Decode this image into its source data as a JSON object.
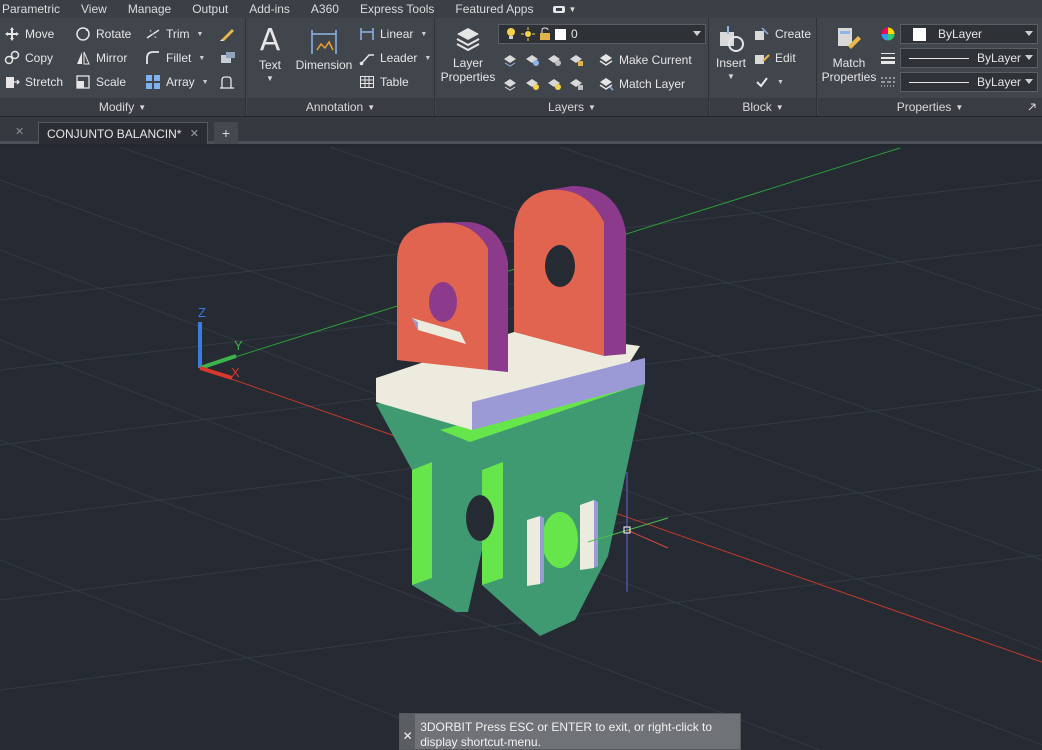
{
  "menubar": {
    "items": [
      "Parametric",
      "View",
      "Manage",
      "Output",
      "Add-ins",
      "A360",
      "Express Tools",
      "Featured Apps"
    ]
  },
  "ribbon": {
    "modify": {
      "title": "Modify",
      "move": "Move",
      "rotate": "Rotate",
      "trim": "Trim",
      "copy": "Copy",
      "mirror": "Mirror",
      "fillet": "Fillet",
      "stretch": "Stretch",
      "scale": "Scale",
      "array": "Array"
    },
    "annotation": {
      "title": "Annotation",
      "text": "Text",
      "dimension": "Dimension",
      "linear": "Linear",
      "leader": "Leader",
      "table": "Table"
    },
    "layers": {
      "title": "Layers",
      "layer_properties": "Layer\nProperties",
      "current_layer": "0",
      "make_current": "Make Current",
      "match_layer": "Match Layer"
    },
    "block": {
      "title": "Block",
      "insert": "Insert",
      "create": "Create",
      "edit": "Edit"
    },
    "properties": {
      "title": "Properties",
      "match_properties": "Match\nProperties",
      "color": "ByLayer",
      "linetype": "ByLayer",
      "lineweight": "ByLayer"
    }
  },
  "tabs": {
    "document": "CONJUNTO BALANCIN*"
  },
  "ucs": {
    "z": "Z",
    "y": "Y",
    "x": "X"
  },
  "command": {
    "text": "3DORBIT Press ESC or ENTER to exit, or right-click to display shortcut-menu."
  },
  "colors": {
    "ribbon_bg": "#41454c",
    "viewport_bg": "#262a33",
    "part_red": "#e0644f",
    "part_purple": "#8c3a8c",
    "part_cream": "#ecebdd",
    "part_lavender": "#9b99d6",
    "part_green": "#3f9a72",
    "part_lime": "#66e64a"
  }
}
